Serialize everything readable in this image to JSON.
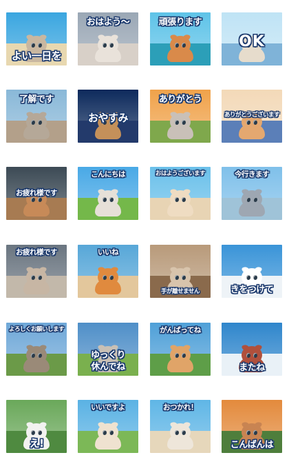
{
  "sticker_grid": {
    "stickers": [
      {
        "caption": "よい一日を",
        "sky": "#3aa6e0",
        "ground": "#e8d8b0",
        "fur": "#c9b7a0",
        "pos": "bottom",
        "fs": "fs-l"
      },
      {
        "caption": "おはよう～",
        "sky": "#9aa7b5",
        "ground": "#d8d0c8",
        "fur": "#e9e2da",
        "pos": "top",
        "fs": "fs-m"
      },
      {
        "caption": "頑張ります",
        "sky": "#5ec3e8",
        "ground": "#2c9fb8",
        "fur": "#d98a4a",
        "pos": "top",
        "fs": "fs-m"
      },
      {
        "caption": "OK",
        "sky": "#bfe3f5",
        "ground": "#7fb3d8",
        "fur": "#e6dccc",
        "pos": "mid",
        "fs": "fs-xl"
      },
      {
        "caption": "了解です",
        "sky": "#89b8d8",
        "ground": "#b3a08a",
        "fur": "#b5a898",
        "pos": "top",
        "fs": "fs-m"
      },
      {
        "caption": "おやすみ",
        "sky": "#0d2a5c",
        "ground": "#233a6b",
        "fur": "#c4905a",
        "pos": "mid",
        "fs": "fs-l"
      },
      {
        "caption": "ありがとう",
        "sky": "#f0a24a",
        "ground": "#7fa84c",
        "fur": "#c9c0b8",
        "pos": "top",
        "fs": "fs-m"
      },
      {
        "caption": "ありがとうございます",
        "sky": "#f3d9b8",
        "ground": "#5b7fb8",
        "fur": "#e4a870",
        "pos": "mid",
        "fs": "fs-xs"
      },
      {
        "caption": "お疲れ様です",
        "sky": "#3c4a55",
        "ground": "#a77b52",
        "fur": "#c78a58",
        "pos": "mid",
        "fs": "fs-s"
      },
      {
        "caption": "こんにちは",
        "sky": "#49a9e6",
        "ground": "#74b84a",
        "fur": "#e6e0d8",
        "pos": "top",
        "fs": "fs-s"
      },
      {
        "caption": "おはようございます",
        "sky": "#6ac0ea",
        "ground": "#e8d4b4",
        "fur": "#efdcc2",
        "pos": "top",
        "fs": "fs-xs"
      },
      {
        "caption": "今行きます",
        "sky": "#7fc0ea",
        "ground": "#9fc3d8",
        "fur": "#9ea7b2",
        "pos": "top",
        "fs": "fs-s"
      },
      {
        "caption": "お疲れ様です",
        "sky": "#6a7580",
        "ground": "#c2b8aa",
        "fur": "#c7b6a4",
        "pos": "top",
        "fs": "fs-s"
      },
      {
        "caption": "いいね",
        "sky": "#57a7d8",
        "ground": "#e3c79c",
        "fur": "#e08a3e",
        "pos": "top",
        "fs": "fs-s"
      },
      {
        "caption": "手が離せません",
        "sky": "#b89a7a",
        "ground": "#8a6a4c",
        "fur": "#d8c4ac",
        "pos": "bottom",
        "fs": "fs-xs"
      },
      {
        "caption": "きをつけて",
        "sky": "#3a94d8",
        "ground": "#eef3f7",
        "fur": "#ffffff",
        "pos": "bottom",
        "fs": "fs-m"
      },
      {
        "caption": "よろしくお願いします",
        "sky": "#6fa8d8",
        "ground": "#6b9a48",
        "fur": "#9a8a78",
        "pos": "top",
        "fs": "fs-xs"
      },
      {
        "caption": "ゆっくり休んでね",
        "sky": "#4f8fc8",
        "ground": "#7ab04e",
        "fur": "#c9c0b5",
        "pos": "bottom-ml",
        "fs": "fs-m"
      },
      {
        "caption": "がんばってね",
        "sky": "#4fa0d8",
        "ground": "#5e9e48",
        "fur": "#e0a468",
        "pos": "top",
        "fs": "fs-s"
      },
      {
        "caption": "またね",
        "sky": "#2f86cc",
        "ground": "#e9f1f7",
        "fur": "#b0503c",
        "pos": "bottom",
        "fs": "fs-m"
      },
      {
        "caption": "え!",
        "sky": "#6aa85a",
        "ground": "#4f8a40",
        "fur": "#f2f2f0",
        "pos": "bottom",
        "fs": "fs-l"
      },
      {
        "caption": "いいですよ",
        "sky": "#5ab2e4",
        "ground": "#7cb857",
        "fur": "#efe2d0",
        "pos": "top",
        "fs": "fs-s"
      },
      {
        "caption": "おつかれ！",
        "sky": "#5fb6e6",
        "ground": "#e6d7bb",
        "fur": "#eee6da",
        "pos": "top",
        "fs": "fs-s"
      },
      {
        "caption": "こんばんは",
        "sky": "#e38a3c",
        "ground": "#4e7e3c",
        "fur": "#c88452",
        "pos": "bottom",
        "fs": "fs-m"
      }
    ]
  }
}
